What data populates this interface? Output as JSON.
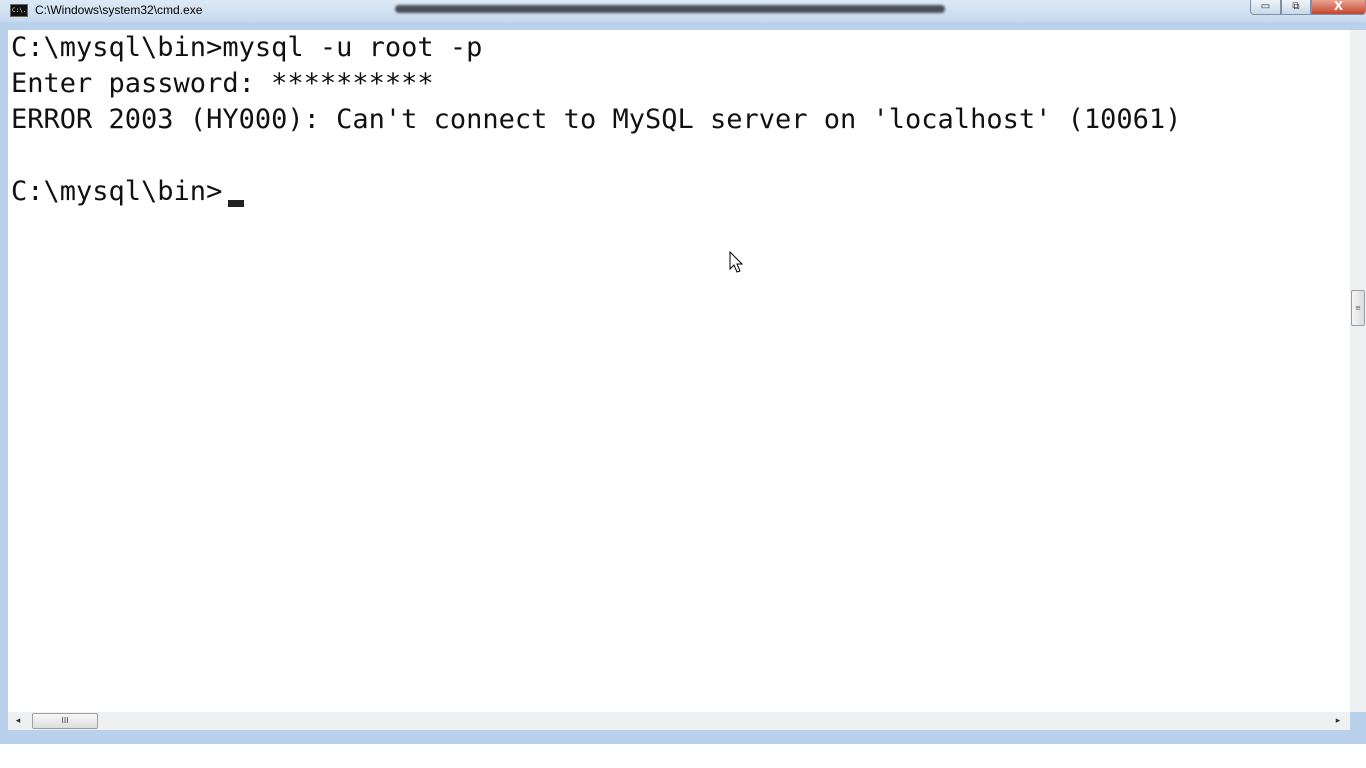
{
  "window": {
    "title": "C:\\Windows\\system32\\cmd.exe",
    "icon_label": "C:\\.",
    "minimize_glyph": "▭",
    "maximize_glyph": "⧉",
    "close_glyph": "X"
  },
  "console": {
    "lines": [
      "C:\\mysql\\bin>mysql -u root -p",
      "Enter password: **********",
      "ERROR 2003 (HY000): Can't connect to MySQL server on 'localhost' (10061)",
      "",
      "C:\\mysql\\bin>"
    ]
  },
  "scrollbars": {
    "left_arrow": "◂",
    "right_arrow": "▸",
    "thumb_grip": "III",
    "vthumb_grip": "≡"
  },
  "colors": {
    "frame": "#b9d1ea",
    "close_button": "#c7442b",
    "console_background": "#ffffff",
    "console_text": "#111111"
  }
}
